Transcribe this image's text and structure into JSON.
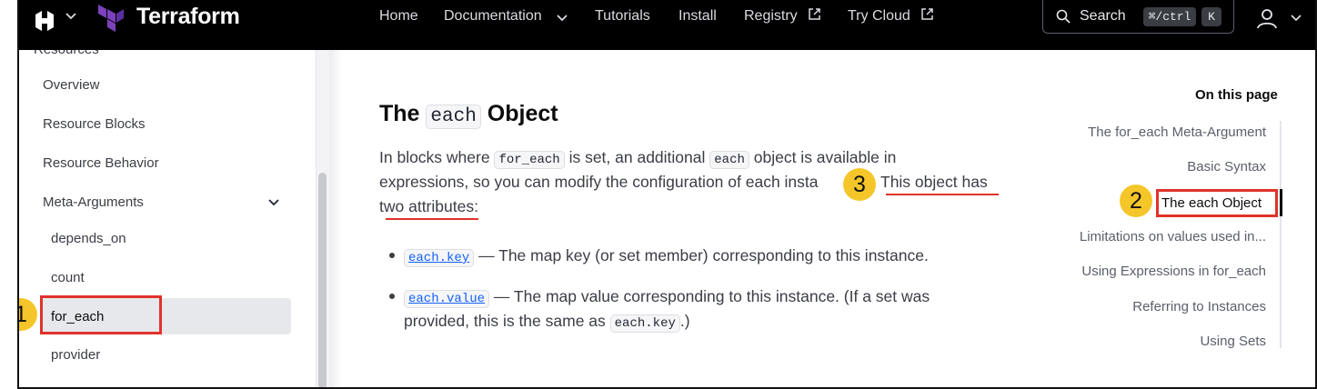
{
  "header": {
    "brand": "Terraform",
    "nav": [
      {
        "label": "Home"
      },
      {
        "label": "Documentation"
      },
      {
        "label": "Tutorials"
      },
      {
        "label": "Install"
      },
      {
        "label": "Registry"
      },
      {
        "label": "Try Cloud"
      }
    ],
    "search": {
      "label": "Search",
      "shortcut": "⌘/ctrl",
      "key": "K"
    }
  },
  "sidebar": {
    "section_cut": "Resources",
    "items": [
      {
        "label": "Overview"
      },
      {
        "label": "Resource Blocks"
      },
      {
        "label": "Resource Behavior"
      },
      {
        "label": "Meta-Arguments"
      },
      {
        "label": "depends_on"
      },
      {
        "label": "count"
      },
      {
        "label": "for_each"
      },
      {
        "label": "provider"
      }
    ],
    "active": "for_each"
  },
  "main": {
    "heading": {
      "pre": "The",
      "code": "each",
      "post": "Object"
    },
    "para": {
      "l1_a": "In blocks where",
      "l1_code1": "for_each",
      "l1_b": "is set, an additional",
      "l1_code2": "each",
      "l1_c": "object is available in",
      "l2": "expressions, so you can modify the configuration of each insta",
      "l2_tail": "This object has",
      "l3": "two attributes:"
    },
    "bullets": [
      {
        "code": "each.key",
        "text": "— The map key (or set member) corresponding to this instance."
      },
      {
        "code": "each.value",
        "text": "— The map value corresponding to this instance. (If a set was",
        "text2_a": "provided, this is the same as",
        "text2_code": "each.key",
        "text2_b": ".)"
      }
    ]
  },
  "on_this_page": {
    "title": "On this page",
    "items": [
      {
        "label": "The for_each Meta-Argument"
      },
      {
        "label": "Basic Syntax"
      },
      {
        "label": "The each Object"
      },
      {
        "label": "Limitations on values used in..."
      },
      {
        "label": "Using Expressions in for_each"
      },
      {
        "label": "Referring to Instances"
      },
      {
        "label": "Using Sets"
      }
    ],
    "active": "The each Object"
  },
  "annotations": {
    "b1": "1",
    "b2": "2",
    "b3": "3"
  },
  "colors": {
    "accent_red": "#e0322a",
    "badge_yellow": "#f5c62a",
    "terraform_purple": "#7b42bc",
    "link_blue": "#1060ff"
  }
}
